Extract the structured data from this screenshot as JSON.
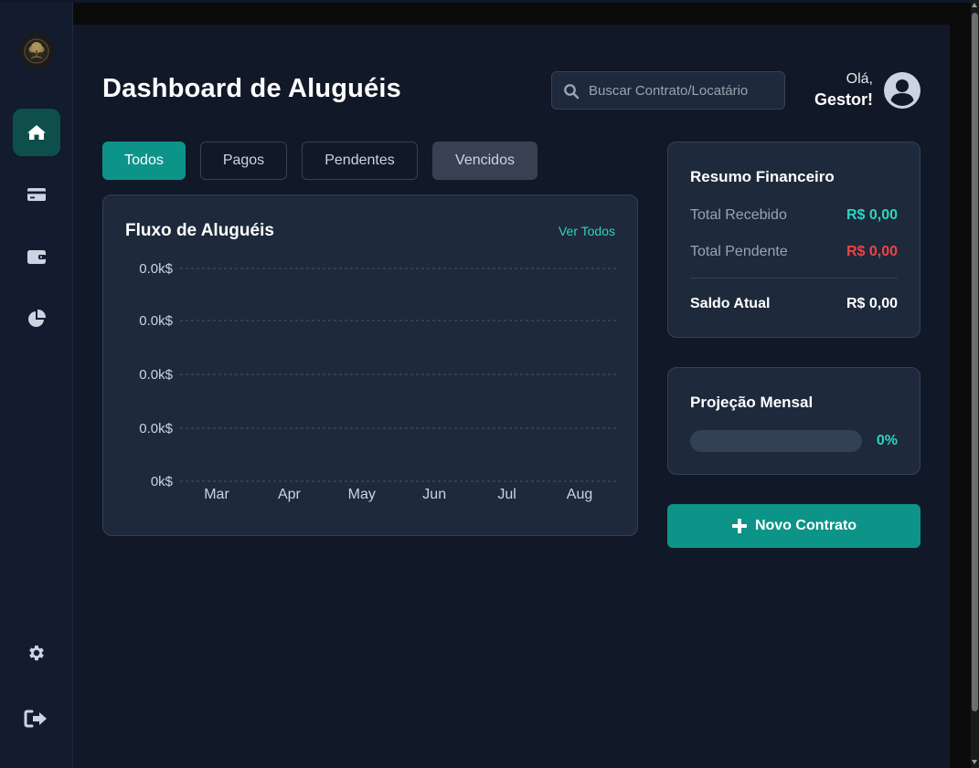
{
  "header": {
    "title": "Dashboard de Aluguéis",
    "search_placeholder": "Buscar Contrato/Locatário",
    "greeting": "Olá,",
    "user_name": "Gestor!"
  },
  "sidebar": {
    "items": [
      {
        "name": "home",
        "icon": "home-icon",
        "active": true
      },
      {
        "name": "payments",
        "icon": "credit-card-icon",
        "active": false
      },
      {
        "name": "wallet",
        "icon": "wallet-icon",
        "active": false
      },
      {
        "name": "reports",
        "icon": "pie-chart-icon",
        "active": false
      }
    ],
    "bottom_items": [
      {
        "name": "settings",
        "icon": "gear-icon"
      },
      {
        "name": "logout",
        "icon": "sign-out-icon"
      }
    ]
  },
  "filters": {
    "tabs": [
      "Todos",
      "Pagos",
      "Pendentes",
      "Vencidos"
    ],
    "active": "Todos"
  },
  "chart_card": {
    "title": "Fluxo de Aluguéis",
    "link": "Ver Todos"
  },
  "chart_data": {
    "type": "line",
    "categories": [
      "Mar",
      "Apr",
      "May",
      "Jun",
      "Jul",
      "Aug"
    ],
    "y_tick_labels": [
      "0.0k$",
      "0.0k$",
      "0.0k$",
      "0.0k$",
      "0k$"
    ],
    "series": [
      {
        "values": [
          0,
          0,
          0,
          0,
          0,
          0
        ]
      }
    ],
    "grid": true,
    "grid_style": "dashed"
  },
  "resumo": {
    "title": "Resumo Financeiro",
    "rows": [
      {
        "label": "Total Recebido",
        "value": "R$ 0,00",
        "color": "#2dd4bf"
      },
      {
        "label": "Total Pendente",
        "value": "R$ 0,00",
        "color": "#ef4444"
      }
    ],
    "total_label": "Saldo Atual",
    "total_value": "R$ 0,00"
  },
  "projecao": {
    "title": "Projeção Mensal",
    "progress_percent": 0,
    "progress_label": "0%"
  },
  "actions": {
    "new_contract": "Novo Contrato"
  },
  "colors": {
    "accent": "#0d9488",
    "accent_text": "#2dd4bf",
    "danger": "#ef4444",
    "background": "#111827",
    "card": "#1e293b"
  }
}
